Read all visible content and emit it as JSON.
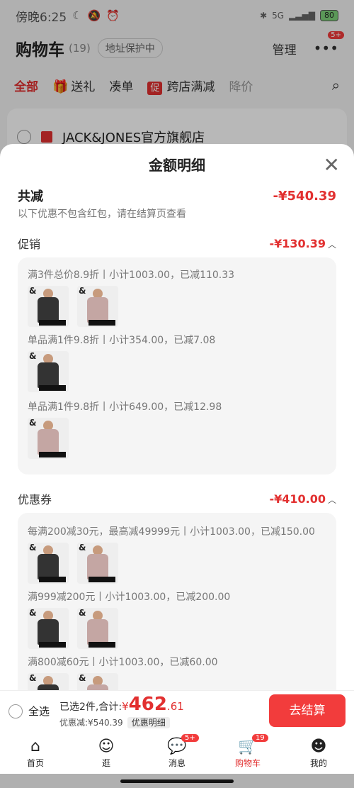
{
  "status": {
    "time": "傍晚6:25",
    "battery": "80",
    "net": "5G"
  },
  "header": {
    "title": "购物车",
    "count": "(19)",
    "address": "地址保护中",
    "manage": "管理",
    "more_badge": "5+"
  },
  "filters": {
    "all": "全部",
    "gift": "送礼",
    "bundle": "凑单",
    "cross_promo_tag": "促",
    "cross_promo": "跨店满减",
    "price_drop": "降价"
  },
  "store": {
    "name": "JACK&JONES官方旗舰店"
  },
  "sheet": {
    "title": "金额明细",
    "total_label": "共减",
    "total_amount": "-¥540.39",
    "note": "以下优惠不包含红包，请在结算页查看",
    "promo": {
      "label": "促销",
      "amount": "-¥130.39",
      "lines": [
        "满3件总价8.9折丨小计1003.00，已减110.33",
        "单品满1件9.8折丨小计354.00，已减7.08",
        "单品满1件9.8折丨小计649.00，已减12.98"
      ]
    },
    "coupon": {
      "label": "优惠券",
      "amount": "-¥410.00",
      "lines": [
        "每满200减30元，最高减49999元丨小计1003.00，已减150.00",
        "满999减200元丨小计1003.00，已减200.00",
        "满800减60元丨小计1003.00，已减60.00"
      ]
    }
  },
  "bottom": {
    "select_all": "全选",
    "selected_text": "已选2件,合计:",
    "currency": "¥",
    "price_int": "462",
    "price_dec": ".61",
    "discount": "优惠减:¥540.39",
    "detail_button": "优惠明细",
    "checkout": "去结算"
  },
  "tabs": [
    {
      "label": "首页"
    },
    {
      "label": "逛"
    },
    {
      "label": "消息",
      "badge": "5+"
    },
    {
      "label": "购物车",
      "badge": "19"
    },
    {
      "label": "我的"
    }
  ]
}
